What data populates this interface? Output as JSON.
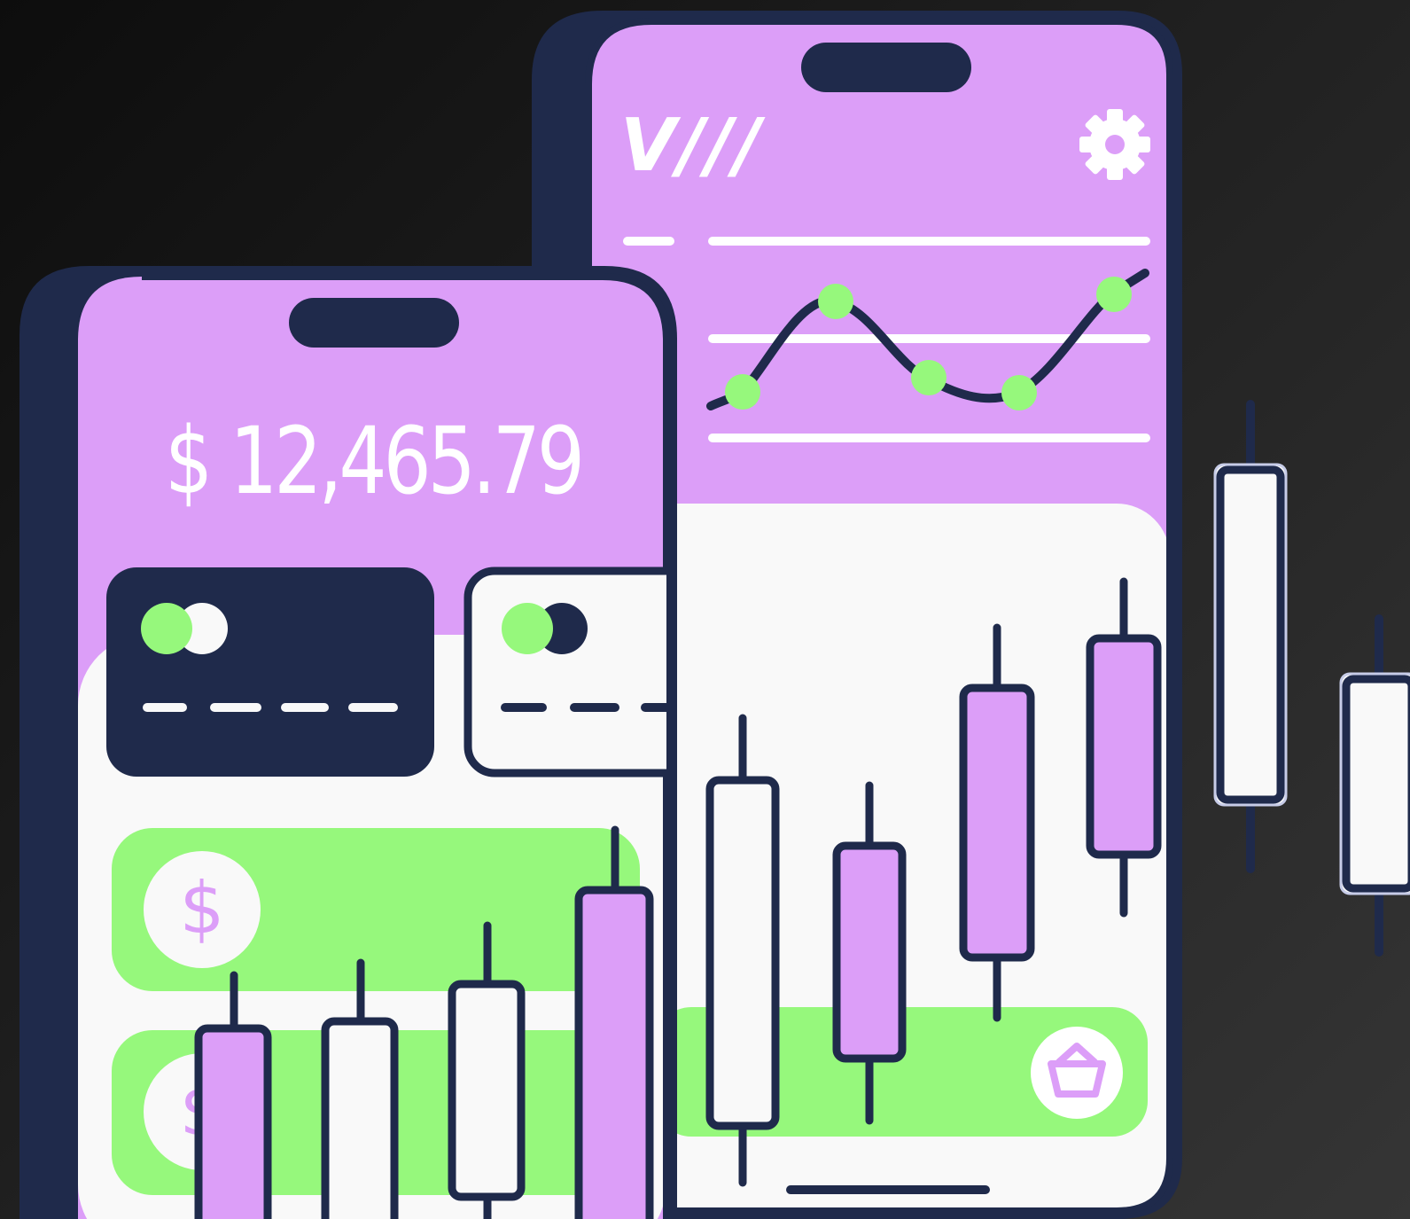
{
  "colors": {
    "navy": "#1f2a4b",
    "lavender": "#dc9ef8",
    "green": "#96f87c",
    "white": "#f9f9f9"
  },
  "front_phone": {
    "balance": "$ 12,465.79"
  },
  "back_phone": {
    "logo": "V///",
    "settings_icon": "gear-icon",
    "basket_icon": "basket-icon",
    "line_chart_point_count": 5
  },
  "decorations": {
    "floating_candles": 2
  }
}
